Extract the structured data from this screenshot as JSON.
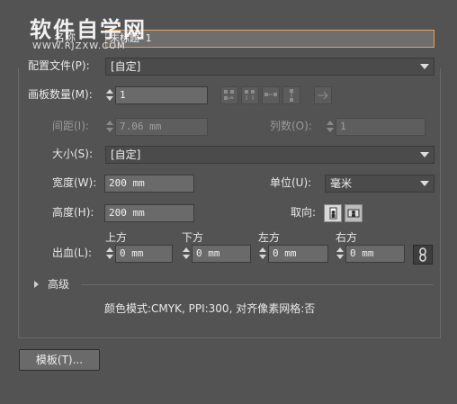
{
  "watermark": {
    "title": "软件自学网",
    "url": "WWW.RJZXW.COM"
  },
  "name": {
    "label_visible": "名称",
    "value": "未标题-1"
  },
  "profile": {
    "label": "配置文件(P):",
    "value": "[自定]"
  },
  "artboards": {
    "label": "画板数量(M):",
    "value": "1"
  },
  "spacing": {
    "label": "间距(I):",
    "value": "7.06 mm"
  },
  "columns": {
    "label": "列数(O):",
    "value": "1"
  },
  "size": {
    "label": "大小(S):",
    "value": "[自定]"
  },
  "width": {
    "label": "宽度(W):",
    "value": "200 mm"
  },
  "units": {
    "label": "单位(U):",
    "value": "毫米"
  },
  "height": {
    "label": "高度(H):",
    "value": "200 mm"
  },
  "orientation": {
    "label": "取向:"
  },
  "bleed": {
    "label": "出血(L):",
    "top": {
      "label": "上方",
      "value": "0 mm"
    },
    "bottom": {
      "label": "下方",
      "value": "0 mm"
    },
    "left": {
      "label": "左方",
      "value": "0 mm"
    },
    "right": {
      "label": "右方",
      "value": "0 mm"
    }
  },
  "advanced": {
    "label": "高级"
  },
  "summary": {
    "text": "颜色模式:CMYK, PPI:300, 对齐像素网格:否"
  },
  "templates_button": {
    "label": "模板(T)..."
  },
  "colors": {
    "bg": "#535353",
    "field": "#6a6a6a",
    "focus": "#e8a050"
  }
}
